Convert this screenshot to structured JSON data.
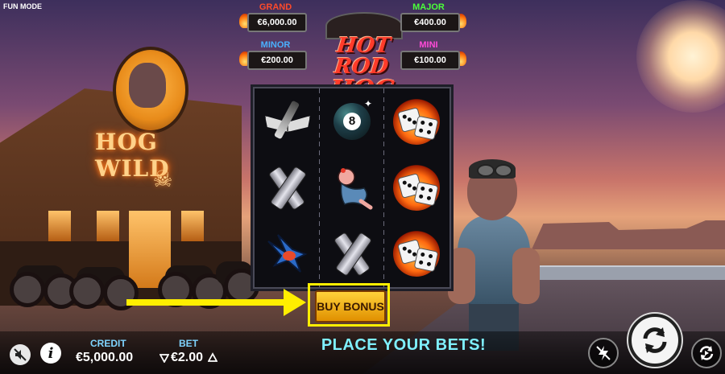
{
  "mode_label": "FUN MODE",
  "game": {
    "title_line1": "HOT ROD",
    "title_line2": "HOG"
  },
  "scene": {
    "saloon_sign": "HOG WILD"
  },
  "jackpots": {
    "grand": {
      "label": "GRAND",
      "value": "€6,000.00",
      "color": "#ff4a2a"
    },
    "major": {
      "label": "MAJOR",
      "value": "€400.00",
      "color": "#4aff3a"
    },
    "minor": {
      "label": "MINOR",
      "value": "€200.00",
      "color": "#4ab0ff"
    },
    "mini": {
      "label": "MINI",
      "value": "€100.00",
      "color": "#ff4ad8"
    }
  },
  "reels": [
    [
      "winged-spark-plug",
      "pistons",
      "swallow"
    ],
    [
      "eight-ball",
      "pinup-pig",
      "pistons"
    ],
    [
      "flaming-dice",
      "flaming-dice",
      "flaming-dice"
    ]
  ],
  "buy_bonus_label": "BUY BONUS",
  "footer": {
    "credit_label": "CREDIT",
    "credit_value": "€5,000.00",
    "bet_label": "BET",
    "bet_value": "€2.00",
    "message": "PLACE YOUR BETS!"
  },
  "colors": {
    "accent_yellow": "#ffee00",
    "label_blue": "#7fd4ff",
    "message_cyan": "#7ff0ff"
  }
}
